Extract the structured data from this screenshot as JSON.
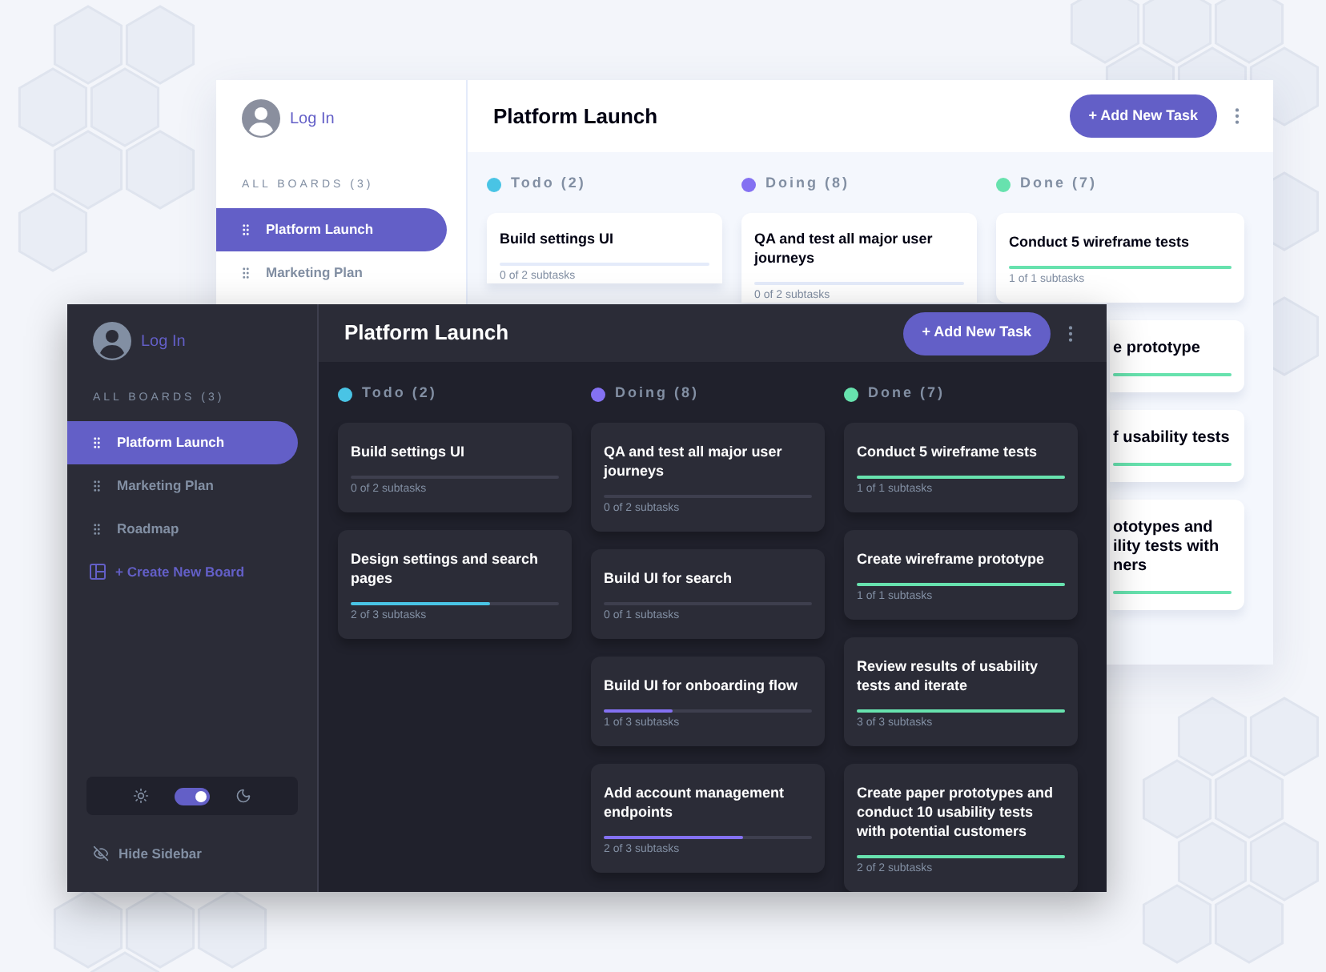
{
  "light_window": {
    "sidebar": {
      "login": "Log In",
      "boards_heading": "ALL BOARDS (3)",
      "boards": [
        {
          "name": "Platform Launch",
          "selected": true
        },
        {
          "name": "Marketing Plan",
          "selected": false
        }
      ]
    },
    "header": {
      "title": "Platform Launch",
      "add_button": "+ Add New Task"
    },
    "columns": [
      {
        "name": "Todo (2)",
        "color": "#49c4e5",
        "tasks": [
          {
            "kind": "cut",
            "title": "Build settings UI",
            "subtasks": "0 of 2 subtasks",
            "level": 0
          }
        ]
      },
      {
        "name": "Doing (8)",
        "color": "#8471f2",
        "tasks": [
          {
            "kind": "cut",
            "title": "QA and test all major user journeys",
            "subtasks": "0 of 2 subtasks",
            "level": 0
          }
        ]
      },
      {
        "name": "Done (7)",
        "color": "#67e2ae",
        "tasks": [
          {
            "kind": "full",
            "title": "Conduct 5 wireframe tests",
            "subtasks": "1 of 1 subtasks",
            "level": 1
          },
          {
            "kind": "partial",
            "title": "e prototype",
            "level": 1
          },
          {
            "kind": "partial",
            "title": "f usability tests",
            "level": 1
          },
          {
            "kind": "partial",
            "title": "ototypes and\nility tests with\nners",
            "level": 1
          }
        ]
      }
    ]
  },
  "dark_window": {
    "sidebar": {
      "login": "Log In",
      "boards_heading": "ALL BOARDS (3)",
      "boards": [
        {
          "name": "Platform Launch",
          "selected": true
        },
        {
          "name": "Marketing Plan",
          "selected": false
        },
        {
          "name": "Roadmap",
          "selected": false
        }
      ],
      "create_board": "+ Create New Board",
      "dark_mode": {
        "on": true
      },
      "hide_sidebar": "Hide Sidebar"
    },
    "header": {
      "title": "Platform Launch",
      "add_button": "+ Add New Task"
    },
    "columns": [
      {
        "name": "Todo (2)",
        "color": "#49c4e5",
        "tasks": [
          {
            "kind": "full",
            "title": "Build settings UI",
            "subtasks": "0 of 2 subtasks",
            "level": 0
          },
          {
            "kind": "full",
            "title": "Design settings and search pages",
            "subtasks": "2 of 3 subtasks",
            "level": 0.67
          }
        ]
      },
      {
        "name": "Doing (8)",
        "color": "#8471f2",
        "tasks": [
          {
            "kind": "full",
            "title": "QA and test all major user journeys",
            "subtasks": "0 of 2 subtasks",
            "level": 0
          },
          {
            "kind": "full",
            "title": "Build UI for search",
            "subtasks": "0 of 1 subtasks",
            "level": 0
          },
          {
            "kind": "full",
            "title": "Build UI for onboarding flow",
            "subtasks": "1 of 3 subtasks",
            "level": 0.33
          },
          {
            "kind": "full",
            "title": "Add account management endpoints",
            "subtasks": "2 of 3 subtasks",
            "level": 0.67
          }
        ]
      },
      {
        "name": "Done (7)",
        "color": "#67e2ae",
        "tasks": [
          {
            "kind": "full",
            "title": "Conduct 5 wireframe tests",
            "subtasks": "1 of 1 subtasks",
            "level": 1
          },
          {
            "kind": "full",
            "title": "Create wireframe prototype",
            "subtasks": "1 of 1 subtasks",
            "level": 1
          },
          {
            "kind": "full",
            "title": "Review results of usability tests and iterate",
            "subtasks": "3 of 3 subtasks",
            "level": 1
          },
          {
            "kind": "full",
            "title": "Create paper prototypes and conduct 10 usability tests with potential customers",
            "subtasks": "2 of 2 subtasks",
            "level": 1
          }
        ]
      }
    ]
  }
}
